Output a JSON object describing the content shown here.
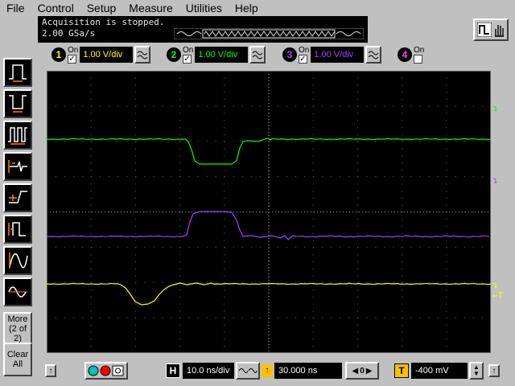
{
  "menu": [
    "File",
    "Control",
    "Setup",
    "Measure",
    "Utilities",
    "Help"
  ],
  "status": {
    "line1": "Acquisition is stopped.",
    "line2": "2.00 GSa/s"
  },
  "channels": [
    {
      "number": "1",
      "on_label": "On",
      "checked": "✓",
      "scale": "1.00 V/div",
      "color": "#ffff00"
    },
    {
      "number": "2",
      "on_label": "On",
      "checked": "✓",
      "scale": "1.00 V/div",
      "color": "#00ff00"
    },
    {
      "number": "3",
      "on_label": "On",
      "checked": "✓",
      "scale": "1.00 V/div",
      "color": "#a040ff"
    },
    {
      "number": "4",
      "on_label": "On",
      "checked": "",
      "scale": "",
      "color": "#ff40ff"
    }
  ],
  "sidebar": {
    "more_label": "More",
    "more_sub": "(2 of 2)",
    "clear_label": "Clear",
    "clear_sub": "All"
  },
  "markers": {
    "ch2": "↴",
    "ch3": "↴",
    "ch1": "↴",
    "trigger": "←T"
  },
  "timebase": {
    "h_label": "H",
    "scale": "10.0 ns/div",
    "position": "30.000 ns",
    "t_label": "T",
    "trigger_level": "-400 mV"
  },
  "colors": {
    "ch1": "#ffff00",
    "ch2": "#00ff00",
    "ch3": "#a040ff",
    "ch4": "#ff40ff",
    "grid": "#606060",
    "screen": "#000000"
  },
  "icons": [
    "pulse-positive-icon",
    "pulse-negative-icon",
    "pulse-train-icon",
    "glitch-icon",
    "edge-icon",
    "period-icon",
    "sine-fit-icon",
    "sine-icon"
  ]
}
